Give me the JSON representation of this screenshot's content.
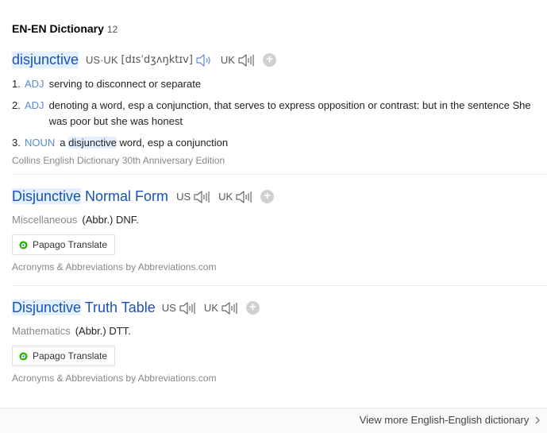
{
  "header": {
    "title": "EN-EN Dictionary",
    "count": "12"
  },
  "entry1": {
    "headword": "disjunctive",
    "us_label": "US·UK",
    "phonetic": "[dɪsˈdʒʌŋktɪv]",
    "uk_label": "UK",
    "definitions": [
      {
        "num": "1.",
        "pos": "ADJ",
        "text": "serving to disconnect or separate"
      },
      {
        "num": "2.",
        "pos": "ADJ",
        "text": "denoting a word, esp a conjunction, that serves to express opposition or contrast: but in the sentence She was poor but she was honest"
      },
      {
        "num": "3.",
        "pos": "NOUN",
        "text_before": "a",
        "text_hl": "disjunctive",
        "text_after": "word, esp a conjunction"
      }
    ],
    "source": "Collins English Dictionary 30th Anniversary Edition"
  },
  "entry2": {
    "headword_hl": "Disjunctive",
    "headword_rest": "Normal Form",
    "us_label": "US",
    "uk_label": "UK",
    "category": "Miscellaneous",
    "abbr": "(Abbr.) DNF.",
    "translate_label": "Papago Translate",
    "source": "Acronyms & Abbreviations by Abbreviations.com"
  },
  "entry3": {
    "headword_hl": "Disjunctive",
    "headword_rest": "Truth Table",
    "us_label": "US",
    "uk_label": "UK",
    "category": "Mathematics",
    "abbr": "(Abbr.) DTT.",
    "translate_label": "Papago Translate",
    "source": "Acronyms & Abbreviations by Abbreviations.com"
  },
  "footer": {
    "more_link": "View more English-English dictionary"
  },
  "icons": {
    "speaker": "speaker-icon",
    "add": "plus-icon",
    "papago": "papago-logo-icon",
    "chevron": "chevron-right-icon"
  },
  "colors": {
    "headword": "#1a52b5",
    "highlight": "#e3f0ff",
    "pos": "#5b8ad6"
  }
}
